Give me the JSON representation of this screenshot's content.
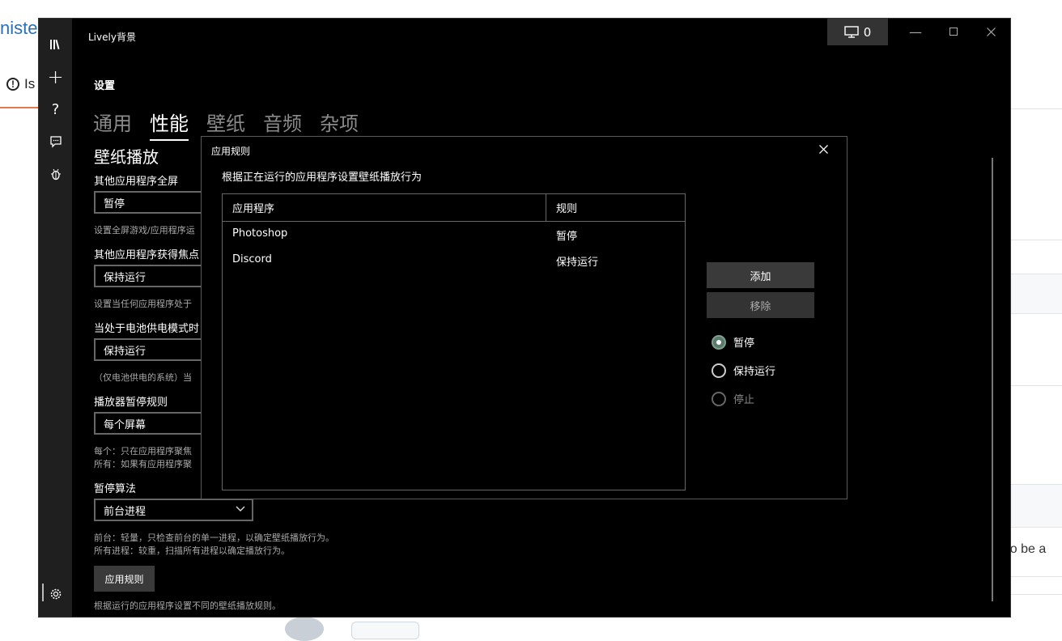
{
  "background": {
    "title_fragment": "niste",
    "tab_fragment": "Is",
    "text_fragment": "d to be a"
  },
  "window": {
    "title": "Lively背景",
    "monitor_count": "0"
  },
  "sidebar": {
    "items": [
      {
        "name": "library-icon",
        "glyph": "𝍢"
      },
      {
        "name": "add-icon",
        "glyph": "+"
      },
      {
        "name": "help-icon",
        "glyph": "?"
      },
      {
        "name": "feedback-icon",
        "glyph": "💬"
      },
      {
        "name": "bug-icon",
        "glyph": "🐞"
      }
    ],
    "settings_glyph": "⚙"
  },
  "page": {
    "header": "设置",
    "tabs": [
      {
        "label": "通用",
        "active": false
      },
      {
        "label": "性能",
        "active": true
      },
      {
        "label": "壁纸",
        "active": false
      },
      {
        "label": "音频",
        "active": false
      },
      {
        "label": "杂项",
        "active": false
      }
    ],
    "section_title": "壁纸播放",
    "settings": [
      {
        "label": "其他应用程序全屏",
        "value": "暂停",
        "desc": "设置全屏游戏/应用程序运"
      },
      {
        "label": "其他应用程序获得焦点",
        "value": "保持运行",
        "desc": "设置当任何应用程序处于"
      },
      {
        "label": "当处于电池供电模式时",
        "value": "保持运行",
        "desc": "（仅电池供电的系统）当"
      },
      {
        "label": "播放器暂停规则",
        "value": "每个屏幕",
        "desc_line1": "每个：只在应用程序聚焦",
        "desc_line2": "所有：如果有应用程序聚"
      },
      {
        "label": "暂停算法",
        "value": "前台进程",
        "desc_line1": "前台：轻量，只检查前台的单一进程，以确定壁纸播放行为。",
        "desc_line2": "所有进程：较重，扫描所有进程以确定播放行为。"
      }
    ],
    "rules_button": "应用规则",
    "rules_desc": "根据运行的应用程序设置不同的壁纸播放规则。"
  },
  "dialog": {
    "title": "应用规则",
    "subtitle": "根据正在运行的应用程序设置壁纸播放行为",
    "columns": [
      "应用程序",
      "规则"
    ],
    "rows": [
      {
        "app": "Photoshop",
        "rule": "暂停"
      },
      {
        "app": "Discord",
        "rule": "保持运行"
      }
    ],
    "add_button": "添加",
    "remove_button": "移除",
    "options": [
      {
        "label": "暂停",
        "selected": true,
        "disabled": false
      },
      {
        "label": "保持运行",
        "selected": false,
        "disabled": false
      },
      {
        "label": "停止",
        "selected": false,
        "disabled": true
      }
    ]
  },
  "colors": {
    "window_bg": "#000000",
    "sidebar_bg": "#1f1f1f",
    "button_bg": "#3a3a3a",
    "radio_selected": "#5a7a6a"
  }
}
